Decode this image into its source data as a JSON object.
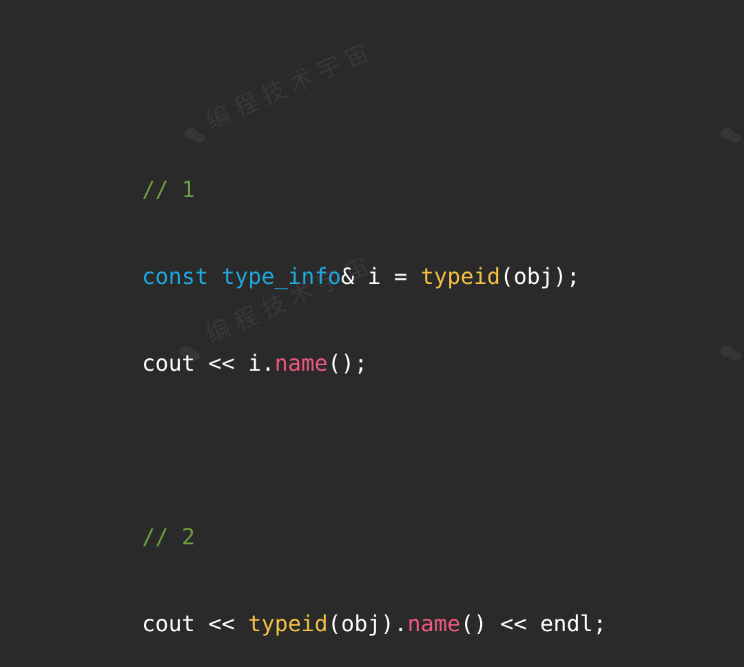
{
  "colors": {
    "background": "#2a2a2a",
    "plain": "#ffffff",
    "comment": "#6a9f3f",
    "keyword": "#1fa8e0",
    "function": "#f4c243",
    "method": "#f0587f",
    "watermark": "#383838"
  },
  "watermark": {
    "text": "编程技术宇宙",
    "icon": "wechat-logo-icon"
  },
  "code": {
    "line1": {
      "comment": "// 1"
    },
    "line2": {
      "t1": "const",
      "t2": " ",
      "t3": "type_info",
      "t4": "& i = ",
      "t5": "typeid",
      "t6": "(obj);"
    },
    "line3": {
      "t1": "cout << i.",
      "t2": "name",
      "t3": "();"
    },
    "line5": {
      "comment": "// 2"
    },
    "line6": {
      "t1": "cout << ",
      "t2": "typeid",
      "t3": "(obj).",
      "t4": "name",
      "t5": "() << endl;"
    }
  }
}
